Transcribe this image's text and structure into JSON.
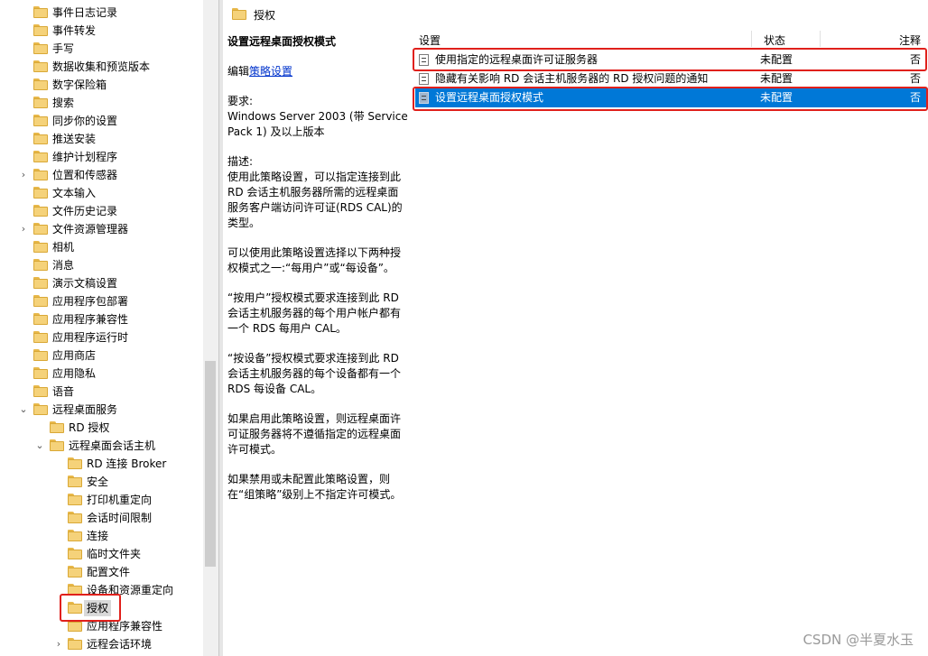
{
  "tree": {
    "items": [
      {
        "label": "事件日志记录",
        "level": 0,
        "expand": ""
      },
      {
        "label": "事件转发",
        "level": 0,
        "expand": ""
      },
      {
        "label": "手写",
        "level": 0,
        "expand": ""
      },
      {
        "label": "数据收集和预览版本",
        "level": 0,
        "expand": ""
      },
      {
        "label": "数字保险箱",
        "level": 0,
        "expand": ""
      },
      {
        "label": "搜索",
        "level": 0,
        "expand": ""
      },
      {
        "label": "同步你的设置",
        "level": 0,
        "expand": ""
      },
      {
        "label": "推送安装",
        "level": 0,
        "expand": ""
      },
      {
        "label": "维护计划程序",
        "level": 0,
        "expand": ""
      },
      {
        "label": "位置和传感器",
        "level": 0,
        "expand": "collapsed"
      },
      {
        "label": "文本输入",
        "level": 0,
        "expand": ""
      },
      {
        "label": "文件历史记录",
        "level": 0,
        "expand": ""
      },
      {
        "label": "文件资源管理器",
        "level": 0,
        "expand": "collapsed"
      },
      {
        "label": "相机",
        "level": 0,
        "expand": ""
      },
      {
        "label": "消息",
        "level": 0,
        "expand": ""
      },
      {
        "label": "演示文稿设置",
        "level": 0,
        "expand": ""
      },
      {
        "label": "应用程序包部署",
        "level": 0,
        "expand": ""
      },
      {
        "label": "应用程序兼容性",
        "level": 0,
        "expand": ""
      },
      {
        "label": "应用程序运行时",
        "level": 0,
        "expand": ""
      },
      {
        "label": "应用商店",
        "level": 0,
        "expand": ""
      },
      {
        "label": "应用隐私",
        "level": 0,
        "expand": ""
      },
      {
        "label": "语音",
        "level": 0,
        "expand": ""
      },
      {
        "label": "远程桌面服务",
        "level": 0,
        "expand": "expanded"
      },
      {
        "label": "RD 授权",
        "level": 1,
        "expand": ""
      },
      {
        "label": "远程桌面会话主机",
        "level": 1,
        "expand": "expanded"
      },
      {
        "label": "RD 连接 Broker",
        "level": 2,
        "expand": ""
      },
      {
        "label": "安全",
        "level": 2,
        "expand": ""
      },
      {
        "label": "打印机重定向",
        "level": 2,
        "expand": ""
      },
      {
        "label": "会话时间限制",
        "level": 2,
        "expand": ""
      },
      {
        "label": "连接",
        "level": 2,
        "expand": ""
      },
      {
        "label": "临时文件夹",
        "level": 2,
        "expand": ""
      },
      {
        "label": "配置文件",
        "level": 2,
        "expand": ""
      },
      {
        "label": "设备和资源重定向",
        "level": 2,
        "expand": ""
      },
      {
        "label": "授权",
        "level": 2,
        "expand": "",
        "selected": true
      },
      {
        "label": "应用程序兼容性",
        "level": 2,
        "expand": ""
      },
      {
        "label": "远程会话环境",
        "level": 2,
        "expand": "collapsed"
      }
    ]
  },
  "right": {
    "header_title": "授权",
    "description": {
      "title": "设置远程桌面授权模式",
      "edit_prefix": "编辑",
      "edit_link": "策略设置",
      "req_label": "要求:",
      "req_text": "Windows Server 2003 (带 Service Pack 1) 及以上版本",
      "desc_label": "描述:",
      "p1": "使用此策略设置，可以指定连接到此 RD 会话主机服务器所需的远程桌面服务客户端访问许可证(RDS CAL)的类型。",
      "p2": "可以使用此策略设置选择以下两种授权模式之一:“每用户”或“每设备”。",
      "p3": "“按用户”授权模式要求连接到此 RD 会话主机服务器的每个用户帐户都有一个 RDS 每用户 CAL。",
      "p4": "“按设备”授权模式要求连接到此 RD 会话主机服务器的每个设备都有一个 RDS 每设备 CAL。",
      "p5": "如果启用此策略设置，则远程桌面许可证服务器将不遵循指定的远程桌面许可模式。",
      "p6": "如果禁用或未配置此策略设置，则在“组策略”级别上不指定许可模式。"
    },
    "list": {
      "headers": {
        "setting": "设置",
        "state": "状态",
        "note": "注释"
      },
      "rows": [
        {
          "name": "使用指定的远程桌面许可证服务器",
          "state": "未配置",
          "note": "否"
        },
        {
          "name": "隐藏有关影响 RD 会话主机服务器的 RD 授权问题的通知",
          "state": "未配置",
          "note": "否"
        },
        {
          "name": "设置远程桌面授权模式",
          "state": "未配置",
          "note": "否",
          "selected": true
        }
      ]
    }
  },
  "watermark": "CSDN @半夏水玉",
  "colors": {
    "highlight_red": "#e0201b",
    "selection_blue": "#0078d7",
    "folder_yellow": "#f5d27a"
  }
}
